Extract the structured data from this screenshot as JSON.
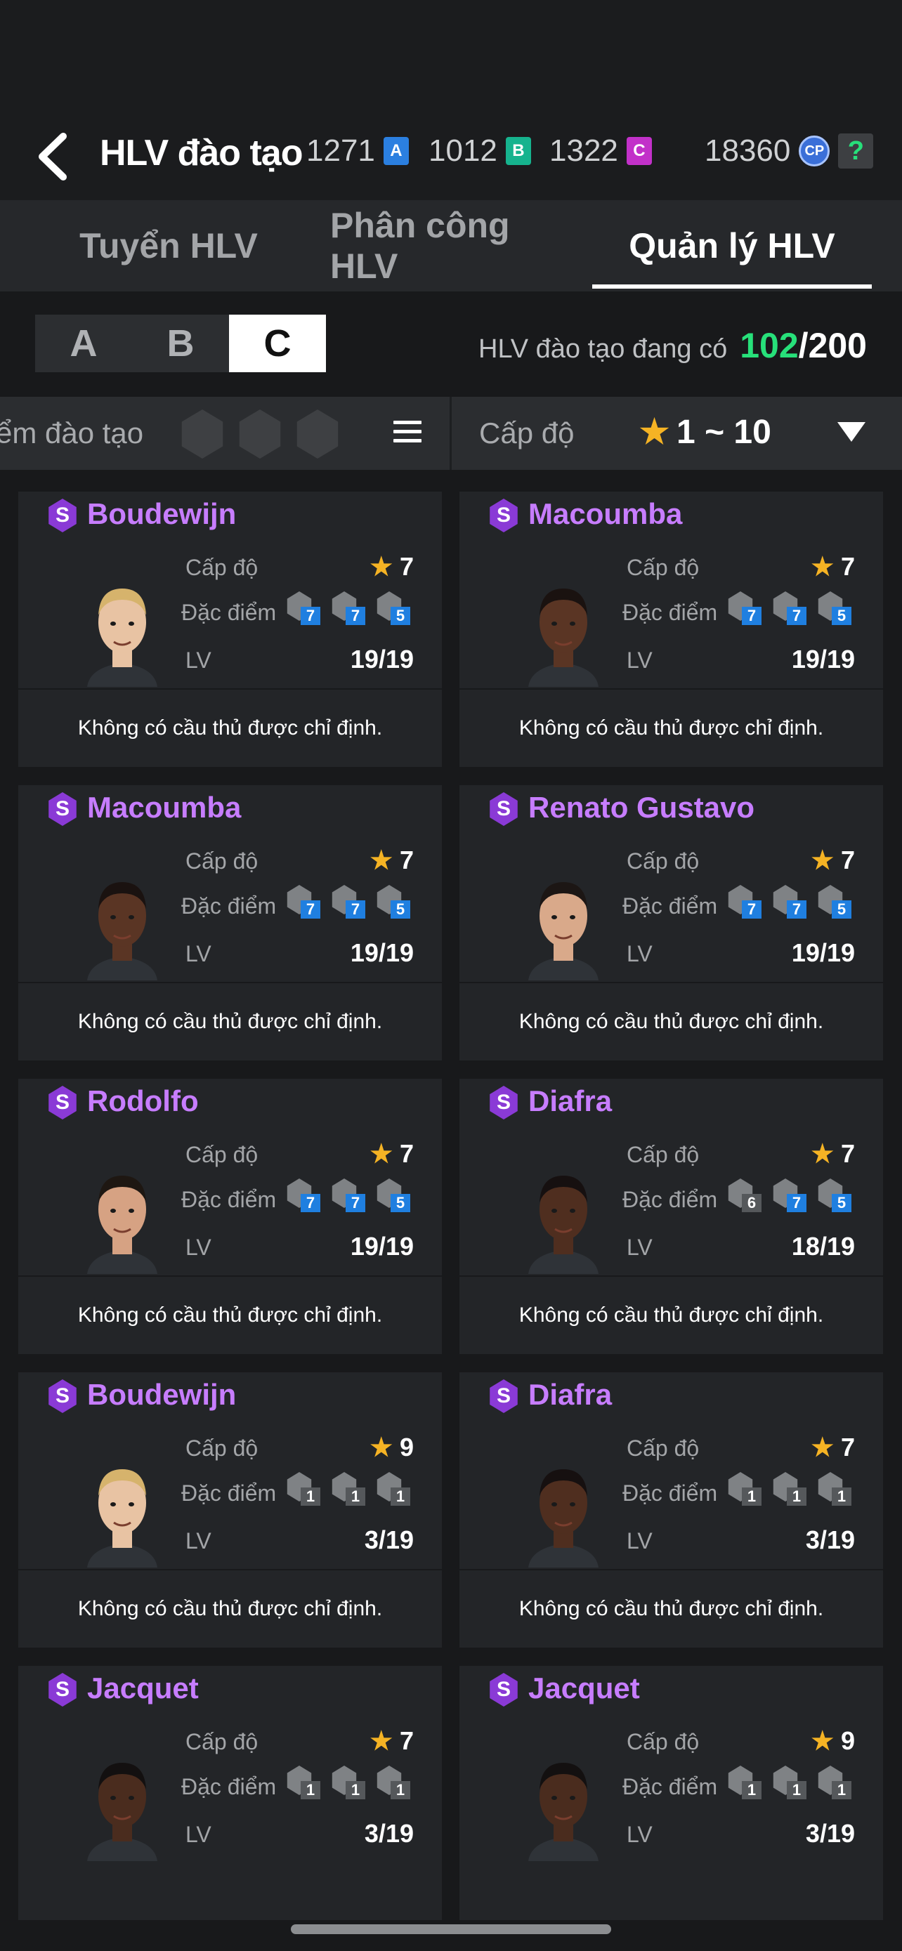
{
  "header": {
    "title": "HLV đào tạo",
    "currencies": [
      {
        "value": "1271",
        "badge": "A",
        "color": "#2b7fe0"
      },
      {
        "value": "1012",
        "badge": "B",
        "color": "#16b38e"
      },
      {
        "value": "1322",
        "badge": "C",
        "color": "#c231c9"
      }
    ],
    "cp": {
      "value": "18360",
      "badge": "CP"
    },
    "help_label": "?"
  },
  "tabs": [
    {
      "label": "Tuyển HLV"
    },
    {
      "label": "Phân công HLV"
    },
    {
      "label": "Quản lý HLV",
      "active": true
    }
  ],
  "grade_selector": {
    "options": [
      "A",
      "B",
      "C"
    ],
    "selected": "C"
  },
  "coach_count": {
    "label": "HLV đào tạo đang có",
    "current": "102",
    "max": "/200"
  },
  "filters": {
    "left_label": "ểm đào tạo",
    "right_label": "Cấp độ",
    "range_text": "1 ~ 10"
  },
  "labels": {
    "level": "Cấp độ",
    "traits": "Đặc điểm",
    "lv": "LV",
    "grade_badge": "S"
  },
  "cards": [
    {
      "name": "Boudewijn",
      "stars": "7",
      "lv": "19/19",
      "traits": [
        "7",
        "7",
        "5"
      ],
      "footer": "Không có cầu thủ được chỉ định.",
      "skin": "#e8c3a3",
      "hair": "#d6b36c"
    },
    {
      "name": "Macoumba",
      "stars": "7",
      "lv": "19/19",
      "traits": [
        "7",
        "7",
        "5"
      ],
      "footer": "Không có cầu thủ được chỉ định.",
      "skin": "#5a3524",
      "hair": "#1a1210"
    },
    {
      "name": "Macoumba",
      "stars": "7",
      "lv": "19/19",
      "traits": [
        "7",
        "7",
        "5"
      ],
      "footer": "Không có cầu thủ được chỉ định.",
      "skin": "#5a3524",
      "hair": "#1a1210"
    },
    {
      "name": "Renato Gustavo",
      "stars": "7",
      "lv": "19/19",
      "traits": [
        "7",
        "7",
        "5"
      ],
      "footer": "Không có cầu thủ được chỉ định.",
      "skin": "#d9a98a",
      "hair": "#1c1614"
    },
    {
      "name": "Rodolfo",
      "stars": "7",
      "lv": "19/19",
      "traits": [
        "7",
        "7",
        "5"
      ],
      "footer": "Không có cầu thủ được chỉ định.",
      "skin": "#d6a283",
      "hair": "#1e1712"
    },
    {
      "name": "Diafra",
      "stars": "7",
      "lv": "18/19",
      "traits": [
        "6",
        "7",
        "5"
      ],
      "footer": "Không có cầu thủ được chỉ định.",
      "skin": "#4f2e1f",
      "hair": "#161010"
    },
    {
      "name": "Boudewijn",
      "stars": "9",
      "lv": "3/19",
      "traits": [
        "1",
        "1",
        "1"
      ],
      "footer": "Không có cầu thủ được chỉ định.",
      "skin": "#e8c3a3",
      "hair": "#d6b36c"
    },
    {
      "name": "Diafra",
      "stars": "7",
      "lv": "3/19",
      "traits": [
        "1",
        "1",
        "1"
      ],
      "footer": "Không có cầu thủ được chỉ định.",
      "skin": "#4f2e1f",
      "hair": "#161010"
    },
    {
      "name": "Jacquet",
      "stars": "7",
      "lv": "3/19",
      "traits": [
        "1",
        "1",
        "1"
      ],
      "footer": "",
      "skin": "#4a2c1e",
      "hair": "#131010"
    },
    {
      "name": "Jacquet",
      "stars": "9",
      "lv": "3/19",
      "traits": [
        "1",
        "1",
        "1"
      ],
      "footer": "",
      "skin": "#4a2c1e",
      "hair": "#131010"
    }
  ],
  "icons": {
    "back": "chevron-left-icon",
    "menu": "menu-icon",
    "dropdown": "triangle-down-icon",
    "star": "star-icon",
    "grade": "s-grade-badge-icon"
  }
}
